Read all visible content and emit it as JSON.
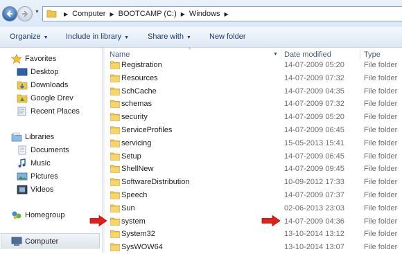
{
  "address": {
    "crumbs": [
      "Computer",
      "BOOTCAMP (C:)",
      "Windows"
    ]
  },
  "toolbar": {
    "organize": "Organize",
    "include": "Include in library",
    "share": "Share with",
    "new_folder": "New folder"
  },
  "nav": {
    "favorites": "Favorites",
    "desktop": "Desktop",
    "downloads": "Downloads",
    "google_drive": "Google Drev",
    "recent": "Recent Places",
    "libraries": "Libraries",
    "documents": "Documents",
    "music": "Music",
    "pictures": "Pictures",
    "videos": "Videos",
    "homegroup": "Homegroup",
    "computer": "Computer"
  },
  "columns": {
    "name": "Name",
    "date": "Date modified",
    "type": "Type"
  },
  "files": [
    {
      "name": "Registration",
      "date": "14-07-2009 05:20",
      "type": "File folder"
    },
    {
      "name": "Resources",
      "date": "14-07-2009 07:32",
      "type": "File folder"
    },
    {
      "name": "SchCache",
      "date": "14-07-2009 04:35",
      "type": "File folder"
    },
    {
      "name": "schemas",
      "date": "14-07-2009 07:32",
      "type": "File folder"
    },
    {
      "name": "security",
      "date": "14-07-2009 05:20",
      "type": "File folder"
    },
    {
      "name": "ServiceProfiles",
      "date": "14-07-2009 06:45",
      "type": "File folder"
    },
    {
      "name": "servicing",
      "date": "15-05-2013 15:41",
      "type": "File folder"
    },
    {
      "name": "Setup",
      "date": "14-07-2009 06:45",
      "type": "File folder"
    },
    {
      "name": "ShellNew",
      "date": "14-07-2009 09:45",
      "type": "File folder"
    },
    {
      "name": "SoftwareDistribution",
      "date": "10-09-2012 17:33",
      "type": "File folder"
    },
    {
      "name": "Speech",
      "date": "14-07-2009 07:37",
      "type": "File folder"
    },
    {
      "name": "Sun",
      "date": "02-06-2013 23:03",
      "type": "File folder"
    },
    {
      "name": "system",
      "date": "14-07-2009 04:36",
      "type": "File folder"
    },
    {
      "name": "System32",
      "date": "13-10-2014 13:12",
      "type": "File folder"
    },
    {
      "name": "SysWOW64",
      "date": "13-10-2014 13:07",
      "type": "File folder"
    }
  ],
  "highlight_color": "#e0201a"
}
